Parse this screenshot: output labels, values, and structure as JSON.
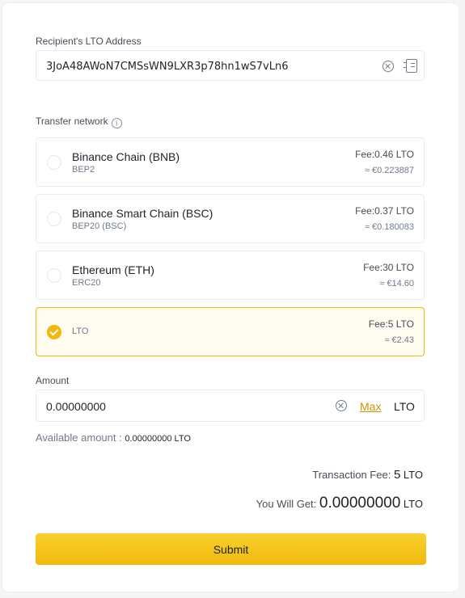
{
  "recipient": {
    "label": "Recipient's LTO Address",
    "value": "3JoA48AWoN7CMSsWN9LXR3p78hn1wS7vLn6"
  },
  "network": {
    "label": "Transfer network",
    "info_glyph": "i",
    "options": [
      {
        "name": "Binance Chain (BNB)",
        "sub": "BEP2",
        "fee": "Fee:0.46 LTO",
        "fee_eur": "≈ €0.223887",
        "selected": false
      },
      {
        "name": "Binance Smart Chain (BSC)",
        "sub": "BEP20 (BSC)",
        "fee": "Fee:0.37 LTO",
        "fee_eur": "≈ €0.180083",
        "selected": false
      },
      {
        "name": "Ethereum (ETH)",
        "sub": "ERC20",
        "fee": "Fee:30 LTO",
        "fee_eur": "≈ €14.60",
        "selected": false
      },
      {
        "name": "",
        "sub": "LTO",
        "fee": "Fee:5 LTO",
        "fee_eur": "≈ €2.43",
        "selected": true
      }
    ]
  },
  "amount": {
    "label": "Amount",
    "value": "0.00000000",
    "max_label": "Max",
    "unit": "LTO"
  },
  "available": {
    "label": "Available amount : ",
    "value": "0.00000000 LTO"
  },
  "summary": {
    "fee_label": "Transaction Fee: ",
    "fee_value": "5",
    "fee_unit": "LTO",
    "get_label": "You Will Get: ",
    "get_value": "0.00000000",
    "get_unit": "LTO"
  },
  "submit_label": "Submit",
  "colors": {
    "accent": "#f0b90b",
    "link": "#c99400",
    "text": "#1e2329",
    "muted": "#707a8a"
  }
}
